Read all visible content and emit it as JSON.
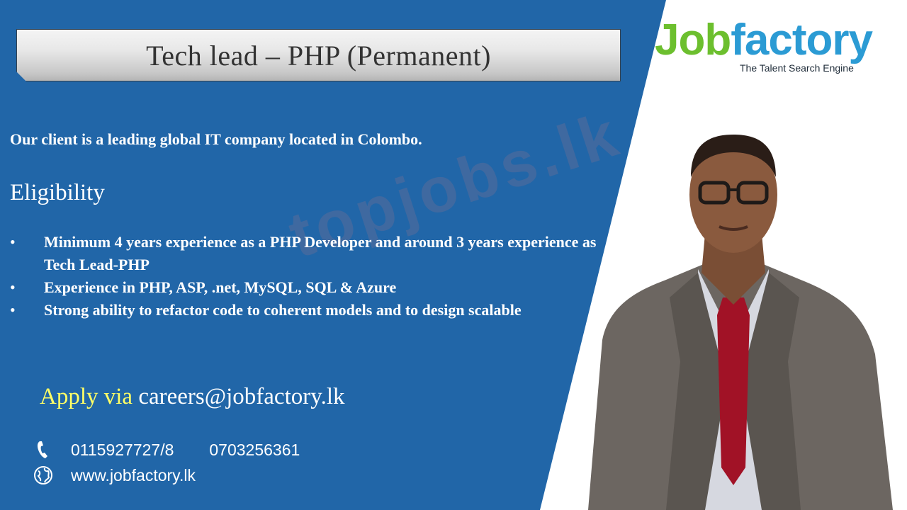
{
  "title": "Tech lead – PHP (Permanent)",
  "logo": {
    "part1": "Job",
    "part2": "factory",
    "tagline": "The Talent Search Engine"
  },
  "intro": "Our client is a leading global IT company located in Colombo.",
  "eligibility_heading": "Eligibility",
  "bullets": [
    "Minimum 4 years experience as a PHP Developer and around 3 years experience as Tech Lead-PHP",
    "Experience in PHP,  ASP, .net, MySQL, SQL & Azure",
    "Strong ability to refactor code to coherent models and to design scalable"
  ],
  "bullet_char": "•",
  "apply": {
    "label": "Apply via",
    "email": "careers@jobfactory.lk"
  },
  "contact": {
    "phone1": "0115927727/8",
    "phone2": "0703256361",
    "website": "www.jobfactory.lk"
  },
  "watermark": "topjobs.lk",
  "colors": {
    "panel": "#2166a8",
    "apply_label": "#ffff66",
    "logo_green": "#6cbf2e",
    "logo_blue": "#2b9bd4"
  },
  "icons": [
    "phone-icon",
    "globe-icon"
  ]
}
